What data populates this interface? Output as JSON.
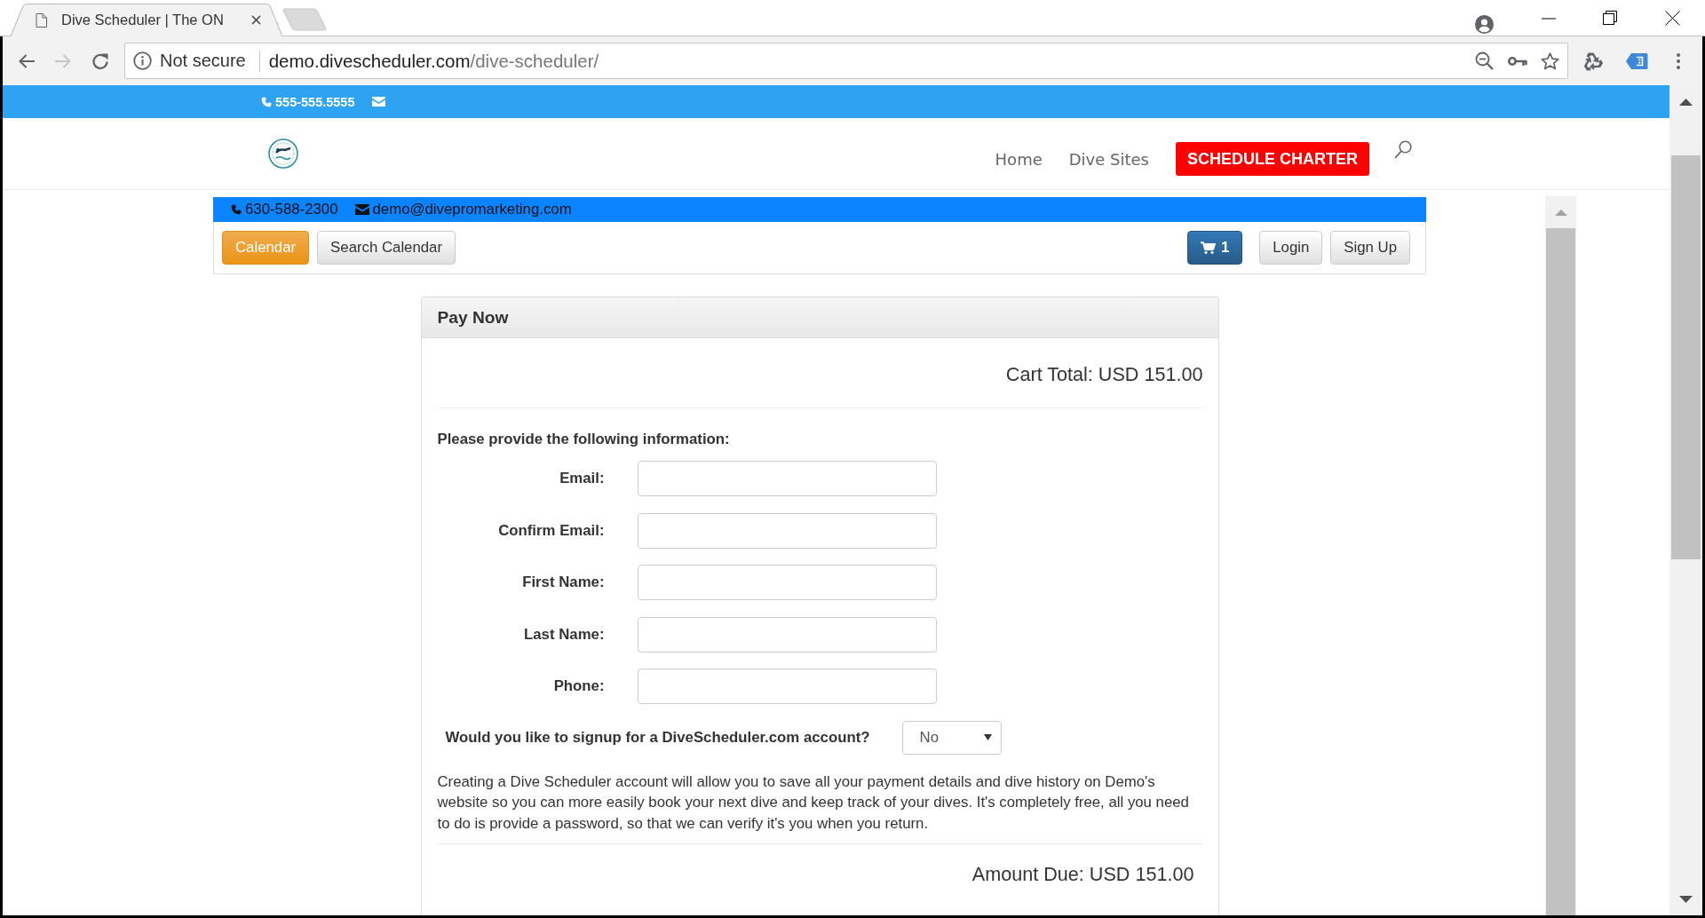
{
  "browser": {
    "tabs": [
      {
        "title": "Dive Scheduler | The ON",
        "selected": true
      }
    ],
    "address": {
      "security": "Not secure",
      "host": "demo.divescheduler.com",
      "path": "/dive-scheduler/"
    }
  },
  "top_bar": {
    "phone": "555-555.5555"
  },
  "header": {
    "nav": [
      {
        "label": "Home",
        "kind": "link"
      },
      {
        "label": "Dive Sites",
        "kind": "link"
      },
      {
        "label": "SCHEDULE CHARTER",
        "kind": "button"
      }
    ]
  },
  "scheduler": {
    "contact": {
      "phone": "630-588-2300",
      "email": "demo@divepromarketing.com"
    },
    "toolbar": {
      "views": [
        {
          "label": "Calendar",
          "kind": "primary"
        },
        {
          "label": "Search Calendar",
          "kind": "default"
        }
      ],
      "cart_count": "1",
      "account": [
        {
          "label": "Login"
        },
        {
          "label": "Sign Up"
        }
      ]
    }
  },
  "pay_now": {
    "title": "Pay Now",
    "cart_total": "Cart Total: USD 151.00",
    "prompt": "Please provide the following information:",
    "fields": [
      {
        "label": "Email:"
      },
      {
        "label": "Confirm Email:"
      },
      {
        "label": "First Name:"
      },
      {
        "label": "Last Name:"
      },
      {
        "label": "Phone:"
      }
    ],
    "signup": {
      "question": "Would you like to signup for a DiveScheduler.com account?",
      "value": "No"
    },
    "note": "Creating a Dive Scheduler account will allow you to save all your payment details and dive history on Demo's website so you can more easily book your next dive and keep track of your dives. It's completely free, all you need to do is provide a password, so that we can verify it's you when you return.",
    "amount_due": "Amount Due: USD 151.00"
  }
}
